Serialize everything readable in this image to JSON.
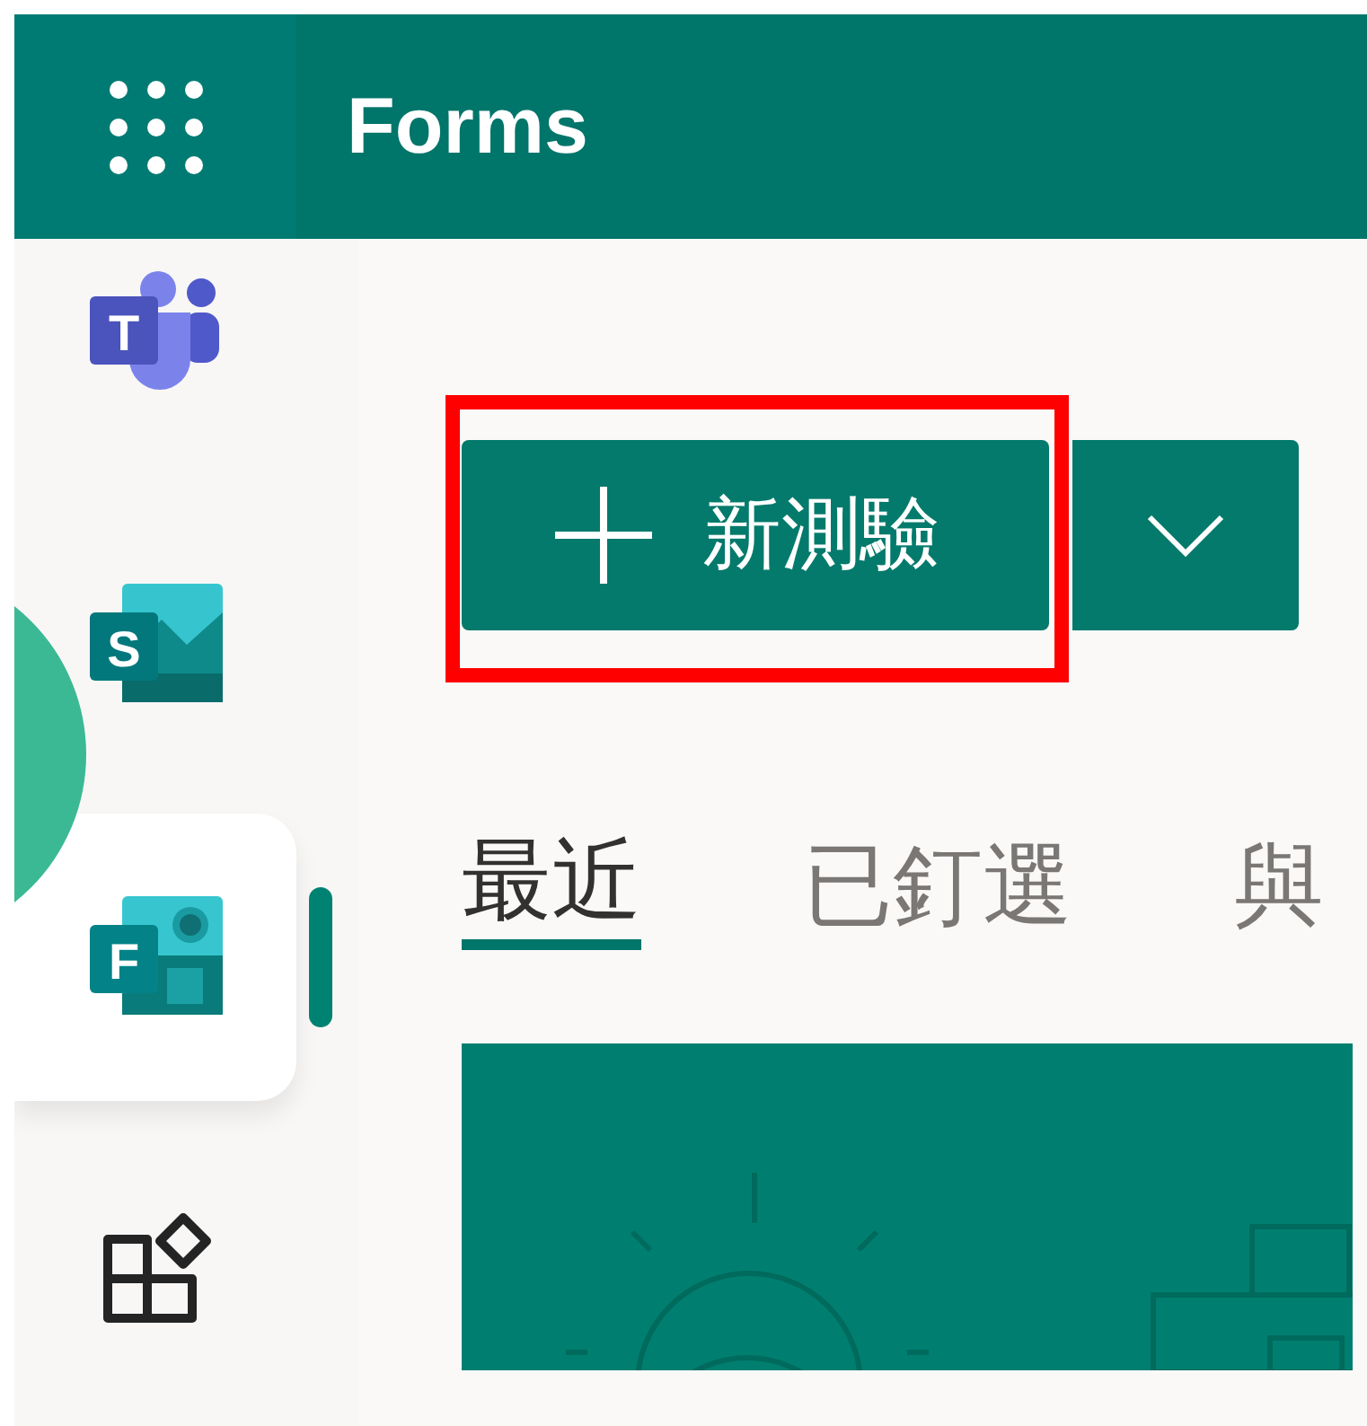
{
  "header": {
    "title": "Forms"
  },
  "sidebar": {
    "items": [
      {
        "kind": "teams",
        "letter": "T",
        "selected": false
      },
      {
        "kind": "sharepoint",
        "letter": "S",
        "selected": false
      },
      {
        "kind": "forms",
        "letter": "F",
        "selected": true
      },
      {
        "kind": "apps",
        "selected": false
      }
    ]
  },
  "new_button": {
    "label": "新測驗",
    "highlighted": true
  },
  "tabs": [
    {
      "label": "最近",
      "selected": true
    },
    {
      "label": "已釘選",
      "selected": false
    },
    {
      "label": "與",
      "selected": false
    }
  ]
}
